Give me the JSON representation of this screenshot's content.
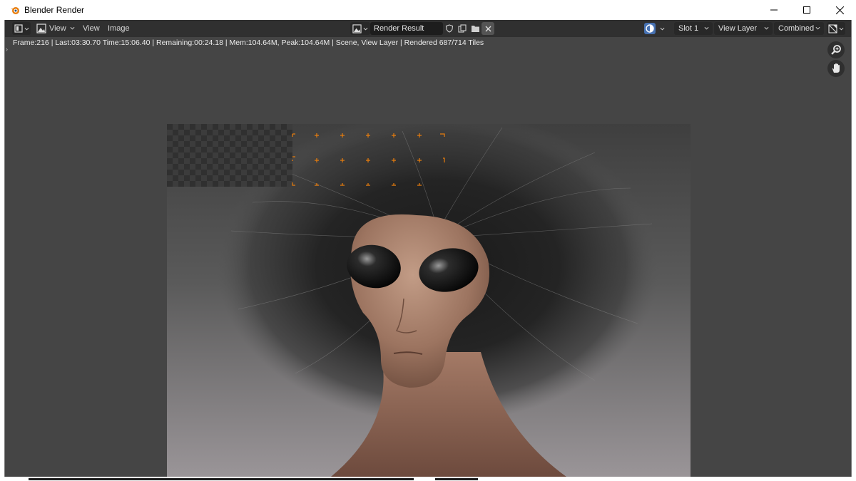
{
  "window": {
    "title": "Blender Render",
    "controls": [
      "minimize-icon",
      "maximize-icon",
      "close-icon"
    ]
  },
  "header": {
    "menus": {
      "view": "View",
      "view2": "View",
      "image": "Image"
    },
    "image_name": "Render Result",
    "slot": "Slot 1",
    "view_layer": "View Layer",
    "pass": "Combined"
  },
  "info": {
    "status_line": "Frame:216 | Last:03:30.70 Time:15:06.40 | Remaining:00:24.18 | Mem:104.64M, Peak:104.64M | Scene, View Layer | Rendered 687/714 Tiles"
  },
  "render": {
    "rendered_tiles": 687,
    "total_tiles": 714,
    "subject": "alien-with-wild-hair-render"
  },
  "colors": {
    "accent_orange": "#e87d0d",
    "header_bg": "#303030",
    "viewport_bg": "#454545",
    "field_bg": "#1d1d1d"
  }
}
